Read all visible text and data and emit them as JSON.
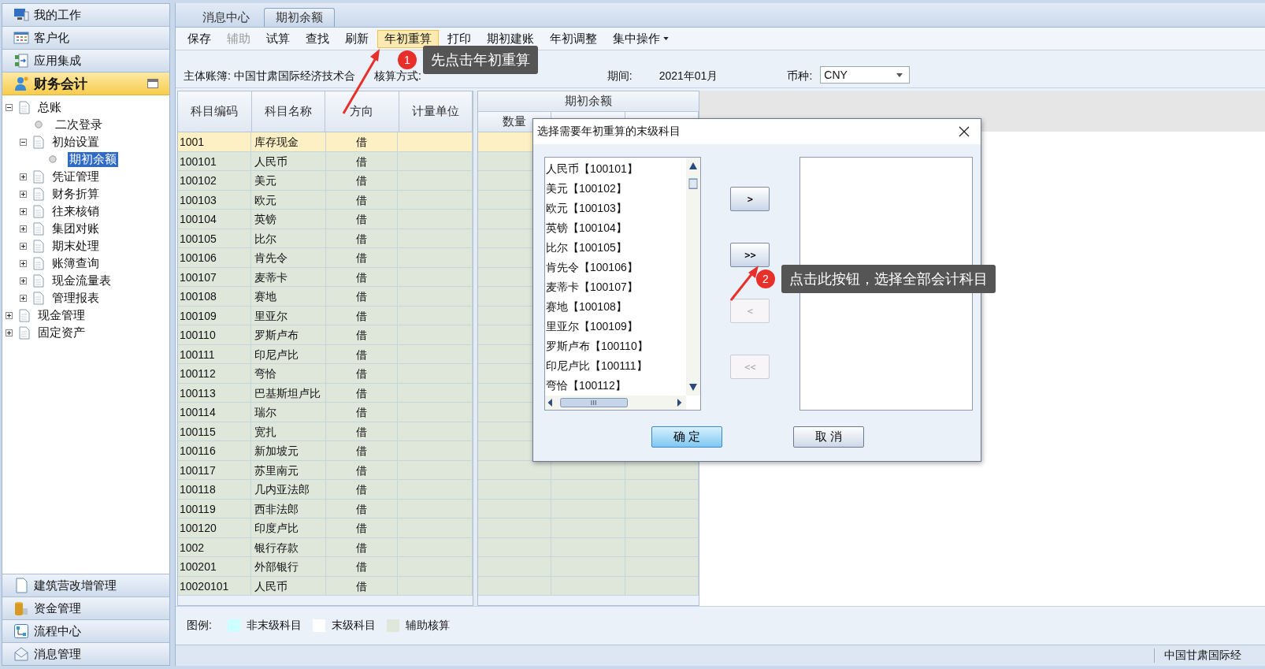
{
  "sidebar": {
    "top_items": [
      {
        "label": "我的工作"
      },
      {
        "label": "客户化"
      },
      {
        "label": "应用集成"
      }
    ],
    "section": {
      "label": "财务会计",
      "expanded": true
    },
    "tree": [
      {
        "label": "总账",
        "kind": "node",
        "expanded": true,
        "selected": false,
        "children": [
          {
            "label": "二次登录",
            "kind": "leaf",
            "selected": false
          },
          {
            "label": "初始设置",
            "kind": "node",
            "expanded": true,
            "selected": false,
            "children": [
              {
                "label": "期初余额",
                "kind": "leaf",
                "selected": true
              }
            ]
          },
          {
            "label": "凭证管理",
            "kind": "node",
            "expanded": false,
            "selected": false
          },
          {
            "label": "财务折算",
            "kind": "node",
            "expanded": false,
            "selected": false
          },
          {
            "label": "往来核销",
            "kind": "node",
            "expanded": false,
            "selected": false
          },
          {
            "label": "集团对账",
            "kind": "node",
            "expanded": false,
            "selected": false
          },
          {
            "label": "期末处理",
            "kind": "node",
            "expanded": false,
            "selected": false
          },
          {
            "label": "账簿查询",
            "kind": "node",
            "expanded": false,
            "selected": false
          },
          {
            "label": "现金流量表",
            "kind": "node",
            "expanded": false,
            "selected": false
          },
          {
            "label": "管理报表",
            "kind": "node",
            "expanded": false,
            "selected": false
          }
        ]
      },
      {
        "label": "现金管理",
        "kind": "node",
        "expanded": false,
        "selected": false
      },
      {
        "label": "固定资产",
        "kind": "node",
        "expanded": false,
        "selected": false
      }
    ],
    "bottom_items": [
      {
        "label": "建筑营改增管理"
      },
      {
        "label": "资金管理"
      },
      {
        "label": "流程中心"
      },
      {
        "label": "消息管理"
      }
    ]
  },
  "tabs": [
    {
      "label": "消息中心",
      "selected": false
    },
    {
      "label": "期初余额",
      "selected": true
    }
  ],
  "toolbar": [
    {
      "label": "保存",
      "disabled": false,
      "selected": false
    },
    {
      "label": "辅助",
      "disabled": true,
      "selected": false
    },
    {
      "label": "试算",
      "disabled": false,
      "selected": false
    },
    {
      "label": "查找",
      "disabled": false,
      "selected": false
    },
    {
      "label": "刷新",
      "disabled": false,
      "selected": false
    },
    {
      "label": "年初重算",
      "disabled": false,
      "selected": true
    },
    {
      "label": "打印",
      "disabled": false,
      "selected": false
    },
    {
      "label": "期初建账",
      "disabled": false,
      "selected": false
    },
    {
      "label": "年初调整",
      "disabled": false,
      "selected": false
    },
    {
      "label": "集中操作",
      "disabled": false,
      "selected": false,
      "dropdown": true
    }
  ],
  "info": {
    "book_label": "主体账簿:",
    "book_value": "中国甘肃国际经济技术合",
    "method_label": "核算方式:",
    "period_label": "期间:",
    "period_value": "2021年01月",
    "currency_label": "币种:",
    "currency_value": "CNY"
  },
  "table": {
    "columns": [
      "科目编码",
      "科目名称",
      "方向",
      "计量单位"
    ],
    "balance_group": "期初余额",
    "balance_columns": [
      "数量"
    ],
    "rows": [
      {
        "code": "1001",
        "name": "库存现金",
        "direction": "借",
        "selected": true
      },
      {
        "code": "100101",
        "name": "人民币",
        "direction": "借",
        "selected": false
      },
      {
        "code": "100102",
        "name": "美元",
        "direction": "借",
        "selected": false
      },
      {
        "code": "100103",
        "name": "欧元",
        "direction": "借",
        "selected": false
      },
      {
        "code": "100104",
        "name": "英镑",
        "direction": "借",
        "selected": false
      },
      {
        "code": "100105",
        "name": "比尔",
        "direction": "借",
        "selected": false
      },
      {
        "code": "100106",
        "name": "肯先令",
        "direction": "借",
        "selected": false
      },
      {
        "code": "100107",
        "name": "麦蒂卡",
        "direction": "借",
        "selected": false
      },
      {
        "code": "100108",
        "name": "赛地",
        "direction": "借",
        "selected": false
      },
      {
        "code": "100109",
        "name": "里亚尔",
        "direction": "借",
        "selected": false
      },
      {
        "code": "100110",
        "name": "罗斯卢布",
        "direction": "借",
        "selected": false
      },
      {
        "code": "100111",
        "name": "印尼卢比",
        "direction": "借",
        "selected": false
      },
      {
        "code": "100112",
        "name": "弯恰",
        "direction": "借",
        "selected": false
      },
      {
        "code": "100113",
        "name": "巴基斯坦卢比",
        "direction": "借",
        "selected": false
      },
      {
        "code": "100114",
        "name": "瑞尔",
        "direction": "借",
        "selected": false
      },
      {
        "code": "100115",
        "name": "宽扎",
        "direction": "借",
        "selected": false
      },
      {
        "code": "100116",
        "name": "新加坡元",
        "direction": "借",
        "selected": false
      },
      {
        "code": "100117",
        "name": "苏里南元",
        "direction": "借",
        "selected": false
      },
      {
        "code": "100118",
        "name": "几内亚法郎",
        "direction": "借",
        "selected": false
      },
      {
        "code": "100119",
        "name": "西非法郎",
        "direction": "借",
        "selected": false
      },
      {
        "code": "100120",
        "name": "印度卢比",
        "direction": "借",
        "selected": false
      },
      {
        "code": "1002",
        "name": "银行存款",
        "direction": "借",
        "selected": false
      },
      {
        "code": "100201",
        "name": "外部银行",
        "direction": "借",
        "selected": false
      },
      {
        "code": "10020101",
        "name": "人民币",
        "direction": "借",
        "selected": false
      }
    ]
  },
  "legend": {
    "label": "图例:",
    "items": [
      {
        "label": "非末级科目",
        "color": "#ccffff"
      },
      {
        "label": "末级科目",
        "color": "#ffffff"
      },
      {
        "label": "辅助核算",
        "color": "#dfe6da"
      }
    ]
  },
  "status_bar": "中国甘肃国际经",
  "dialog": {
    "title": "选择需要年初重算的末级科目",
    "available": [
      "人民币【100101】",
      "美元【100102】",
      "欧元【100103】",
      "英镑【100104】",
      "比尔【100105】",
      "肯先令【100106】",
      "麦蒂卡【100107】",
      "赛地【100108】",
      "里亚尔【100109】",
      "罗斯卢布【100110】",
      "印尼卢比【100111】",
      "弯恰【100112】"
    ],
    "move_buttons": [
      {
        "label": ">",
        "disabled": false
      },
      {
        "label": ">>",
        "disabled": false
      },
      {
        "label": "<",
        "disabled": true
      },
      {
        "label": "<<",
        "disabled": true
      }
    ],
    "ok": "确 定",
    "cancel": "取 消"
  },
  "callouts": [
    {
      "number": "1",
      "text": "先点击年初重算"
    },
    {
      "number": "2",
      "text": "点击此按钮，选择全部会计科目"
    }
  ]
}
